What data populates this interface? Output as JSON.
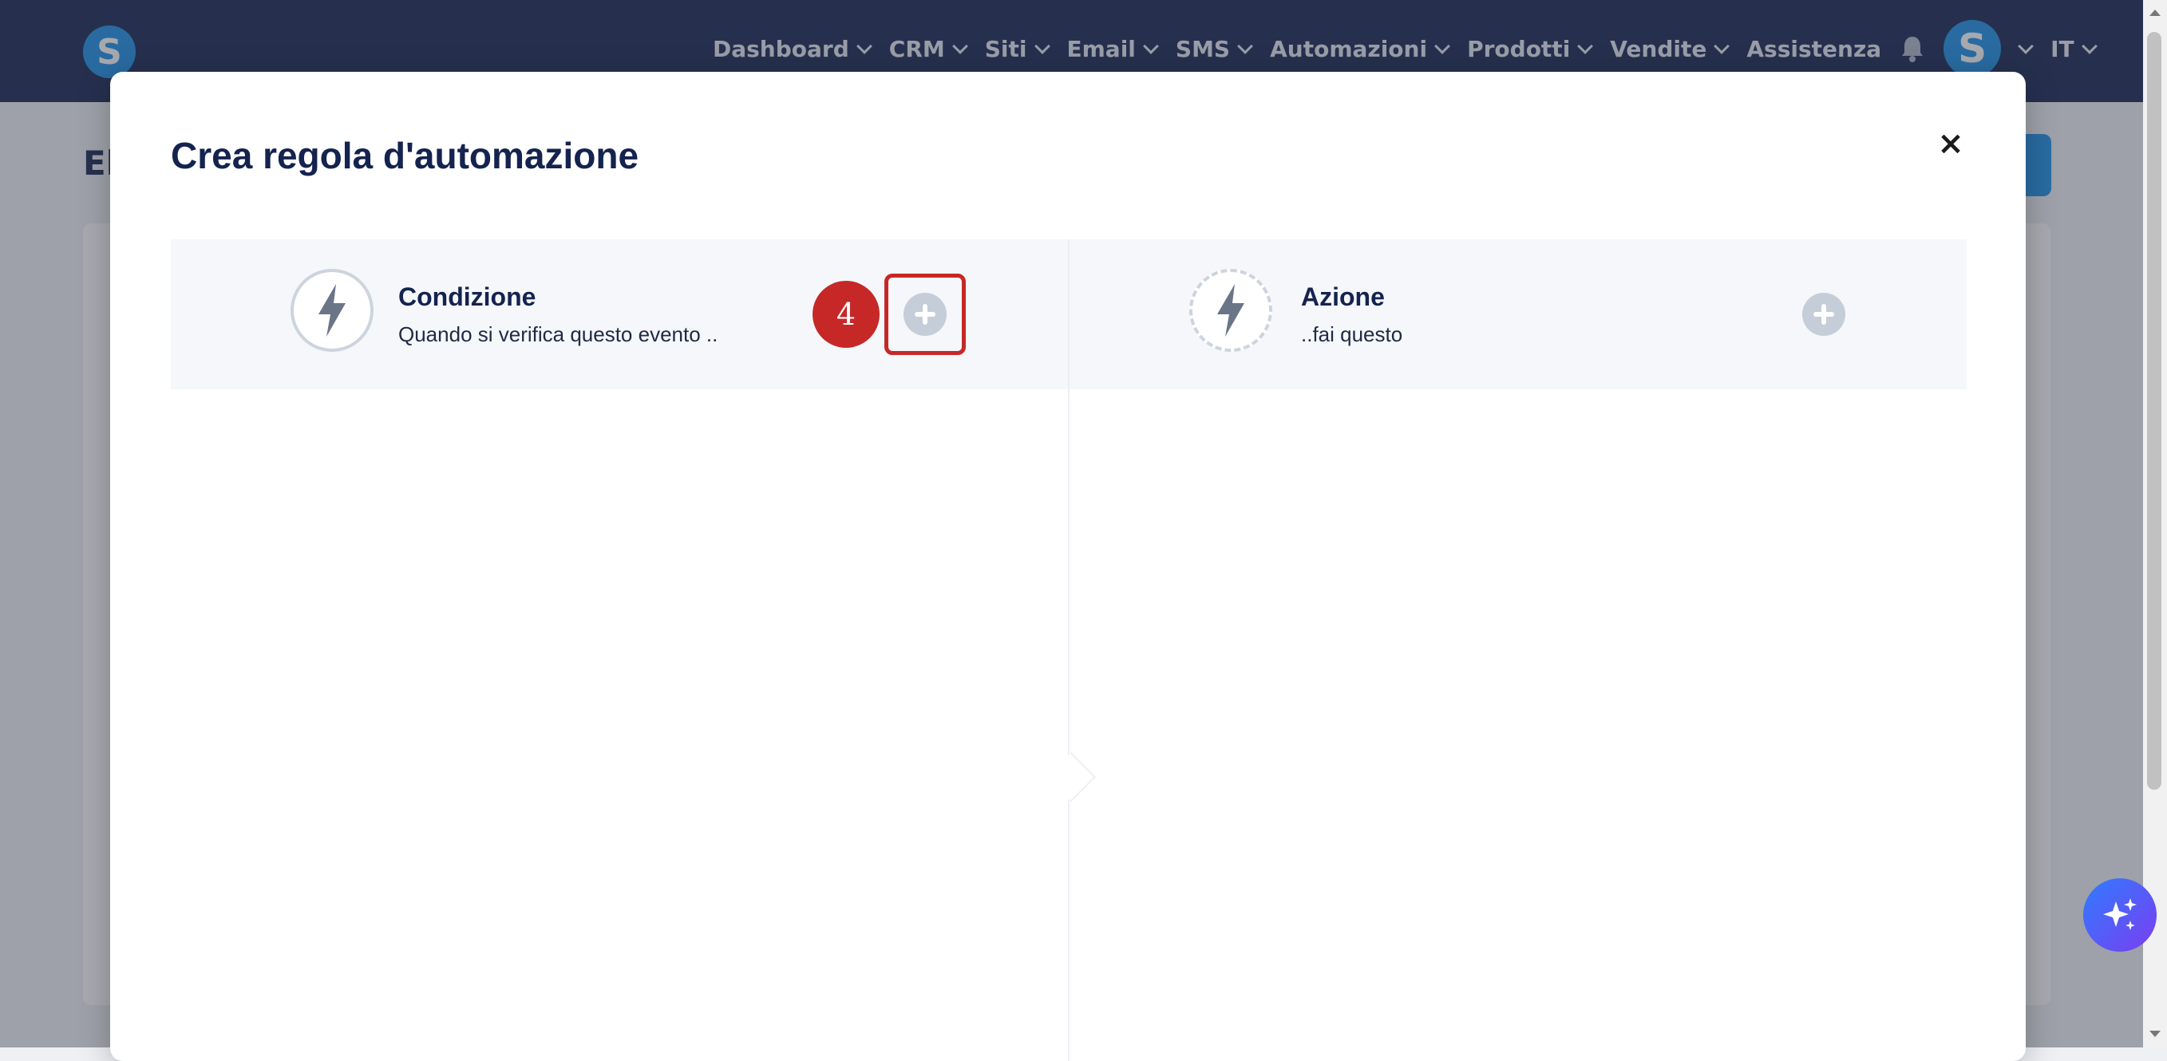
{
  "nav": {
    "logo_letter": "S",
    "items": [
      {
        "label": "Dashboard",
        "has_dropdown": true
      },
      {
        "label": "CRM",
        "has_dropdown": true
      },
      {
        "label": "Siti",
        "has_dropdown": true
      },
      {
        "label": "Email",
        "has_dropdown": true
      },
      {
        "label": "SMS",
        "has_dropdown": true
      },
      {
        "label": "Automazioni",
        "has_dropdown": true
      },
      {
        "label": "Prodotti",
        "has_dropdown": true
      },
      {
        "label": "Vendite",
        "has_dropdown": true
      },
      {
        "label": "Assistenza",
        "has_dropdown": false
      }
    ],
    "avatar_letter": "S",
    "language": "IT"
  },
  "background": {
    "page_title": "El"
  },
  "modal": {
    "title": "Crea regola d'automazione",
    "close_label": "×",
    "condition": {
      "title": "Condizione",
      "subtitle": "Quando si verifica questo evento .."
    },
    "action": {
      "title": "Azione",
      "subtitle": "..fai questo"
    }
  },
  "annotation": {
    "step": "4"
  },
  "colors": {
    "navbar": "#14234f",
    "brand": "#1b8fe6",
    "highlight": "#c62828",
    "plus": "#c5cdd9"
  }
}
